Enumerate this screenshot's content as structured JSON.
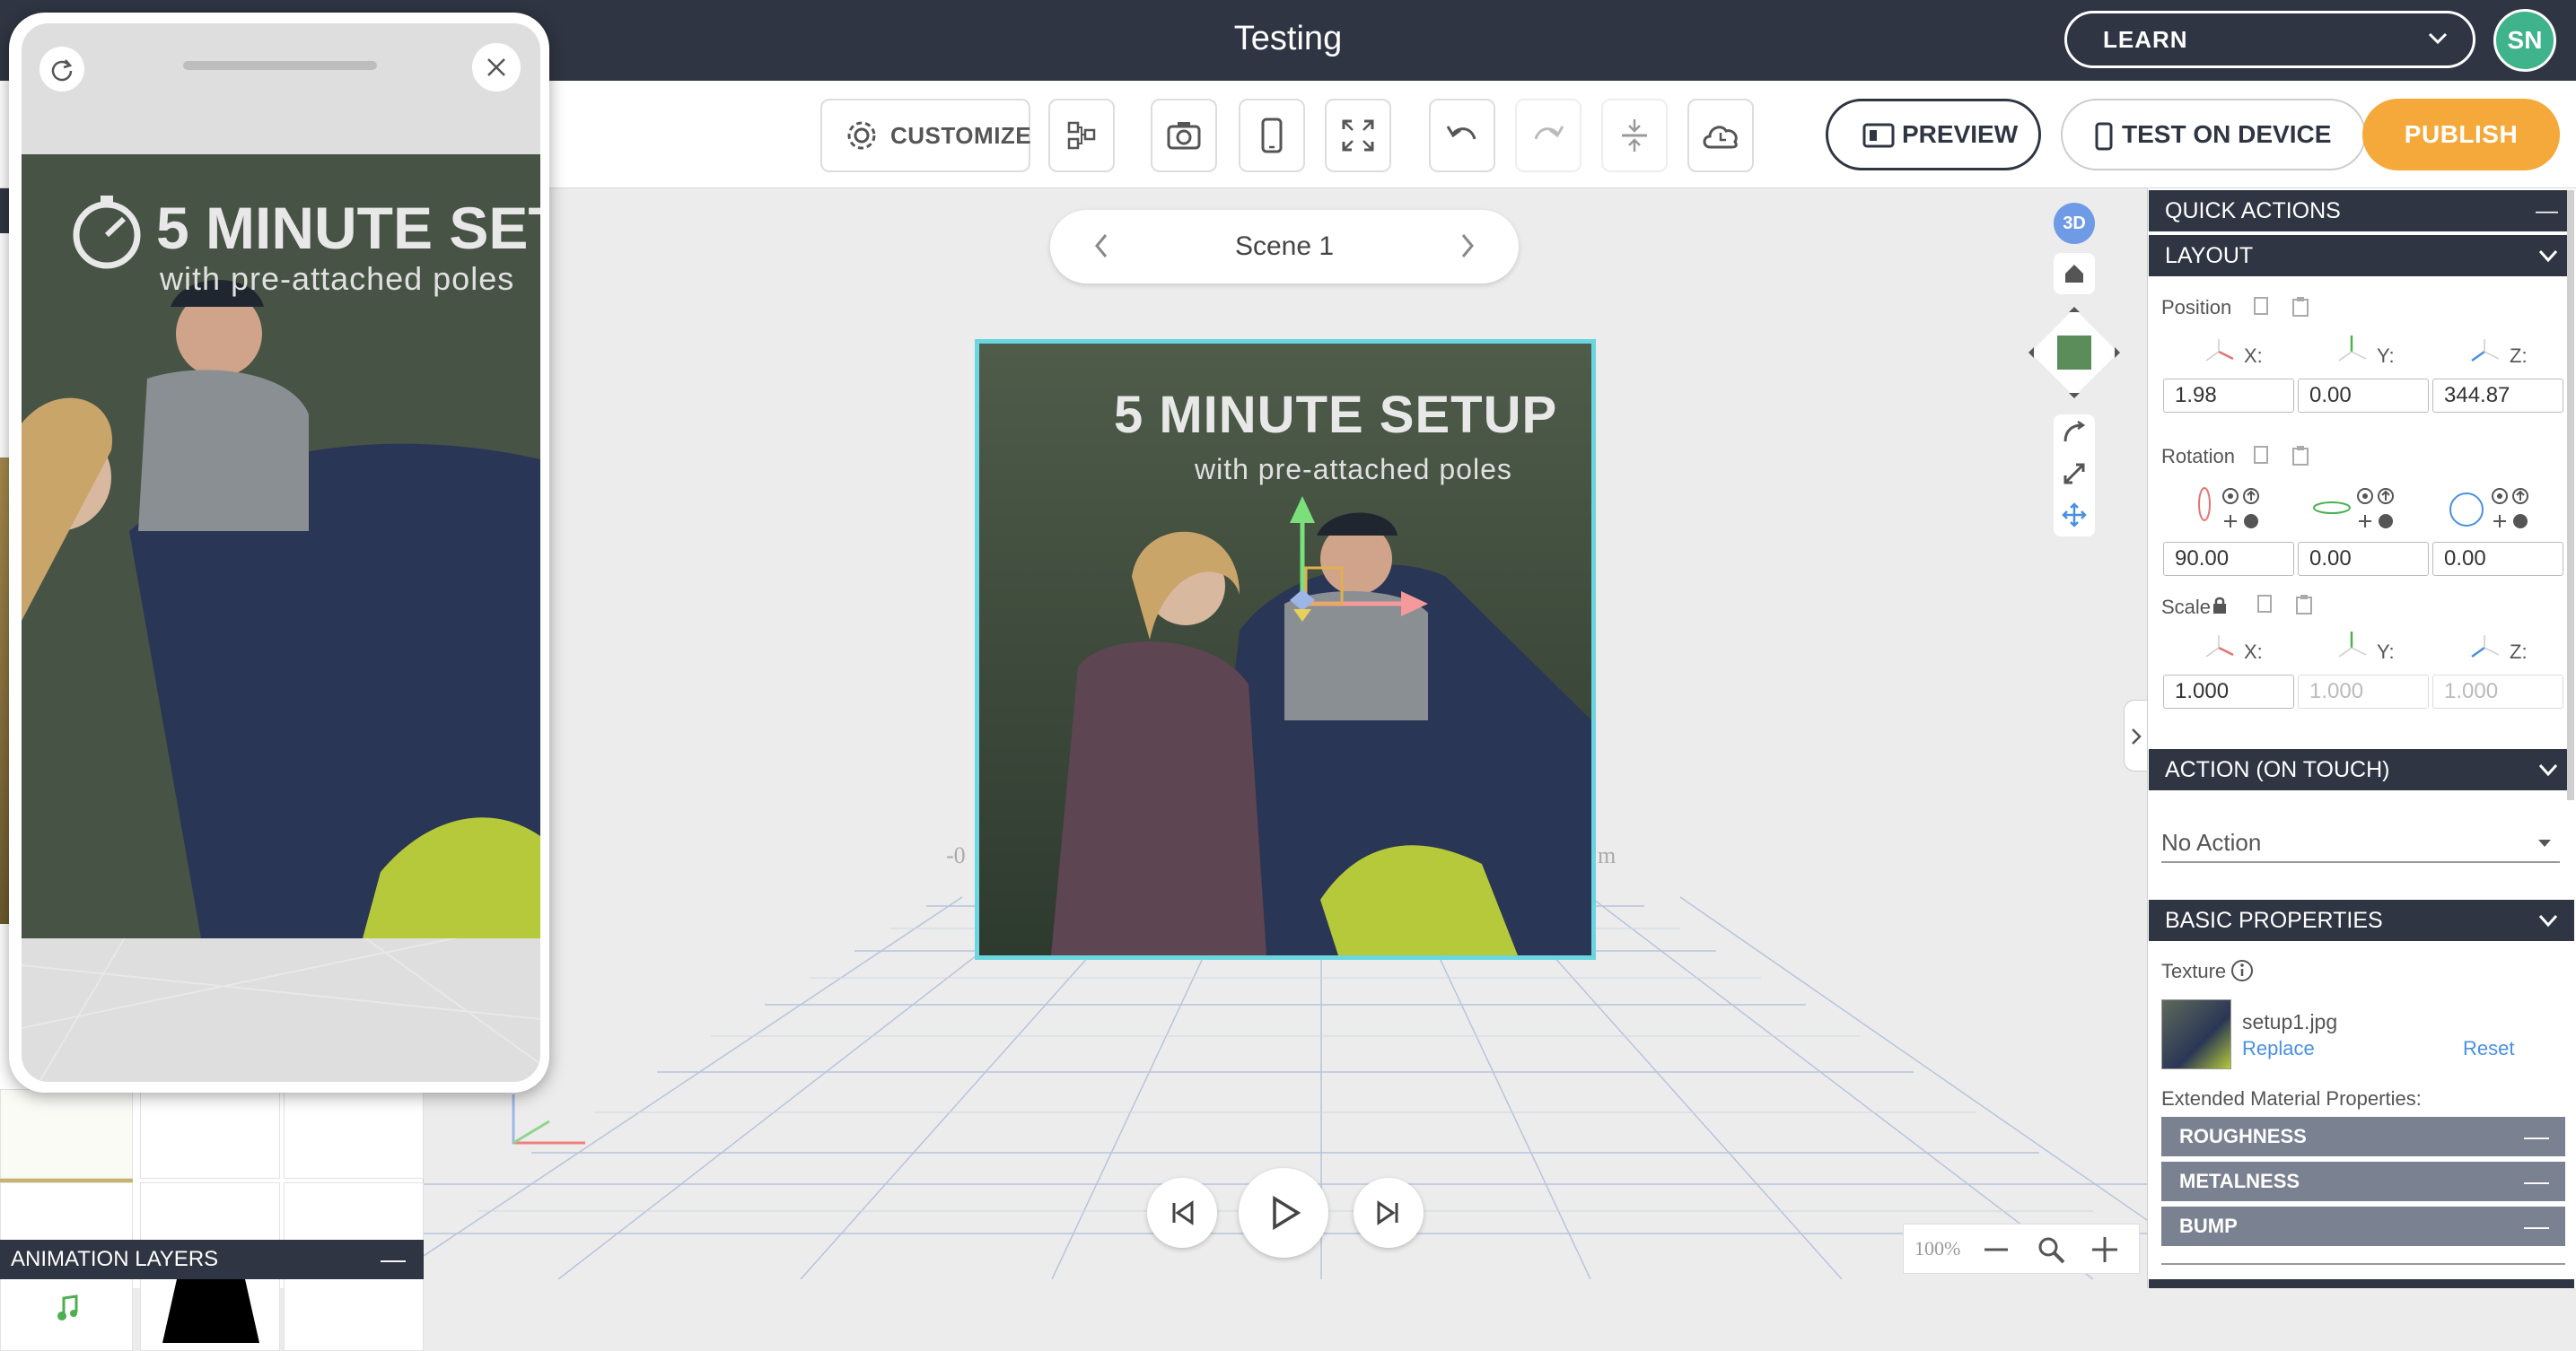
{
  "app": {
    "title": "Testing"
  },
  "header": {
    "learn_label": "LEARN",
    "avatar_initials": "SN"
  },
  "toolbar": {
    "customize_label": "CUSTOMIZE",
    "preview_label": "PREVIEW",
    "test_label": "TEST ON DEVICE",
    "publish_label": "PUBLISH"
  },
  "scene": {
    "name": "Scene 1"
  },
  "canvas": {
    "photo_headline": "5 MINUTE SETUP",
    "photo_subline": "with pre-attached poles",
    "badge_3d": "3D",
    "zoom_level": "100%"
  },
  "left_panel": {
    "animation_layers_label": "ANIMATION LAYERS"
  },
  "right_panel": {
    "quick_actions": "QUICK ACTIONS",
    "layout": "LAYOUT",
    "position_label": "Position",
    "rotation_label": "Rotation",
    "scale_label": "Scale",
    "axis_x": "X:",
    "axis_y": "Y:",
    "axis_z": "Z:",
    "position": {
      "x": "1.98",
      "y": "0.00",
      "z": "344.87"
    },
    "rotation": {
      "x": "90.00",
      "y": "0.00",
      "z": "0.00"
    },
    "scale": {
      "x": "1.000",
      "y": "1.000",
      "z": "1.000"
    },
    "action_header": "ACTION (ON TOUCH)",
    "action_value": "No Action",
    "basic_properties": "BASIC PROPERTIES",
    "texture_label": "Texture",
    "texture_file": "setup1.jpg",
    "replace_label": "Replace",
    "reset_label": "Reset",
    "extended_label": "Extended Material Properties:",
    "roughness": "ROUGHNESS",
    "metalness": "METALNESS",
    "bump": "BUMP"
  },
  "colors": {
    "accent": "#f4a93a",
    "dark": "#2f3542",
    "selection": "#6ad6df",
    "avatar": "#3fb38c"
  }
}
